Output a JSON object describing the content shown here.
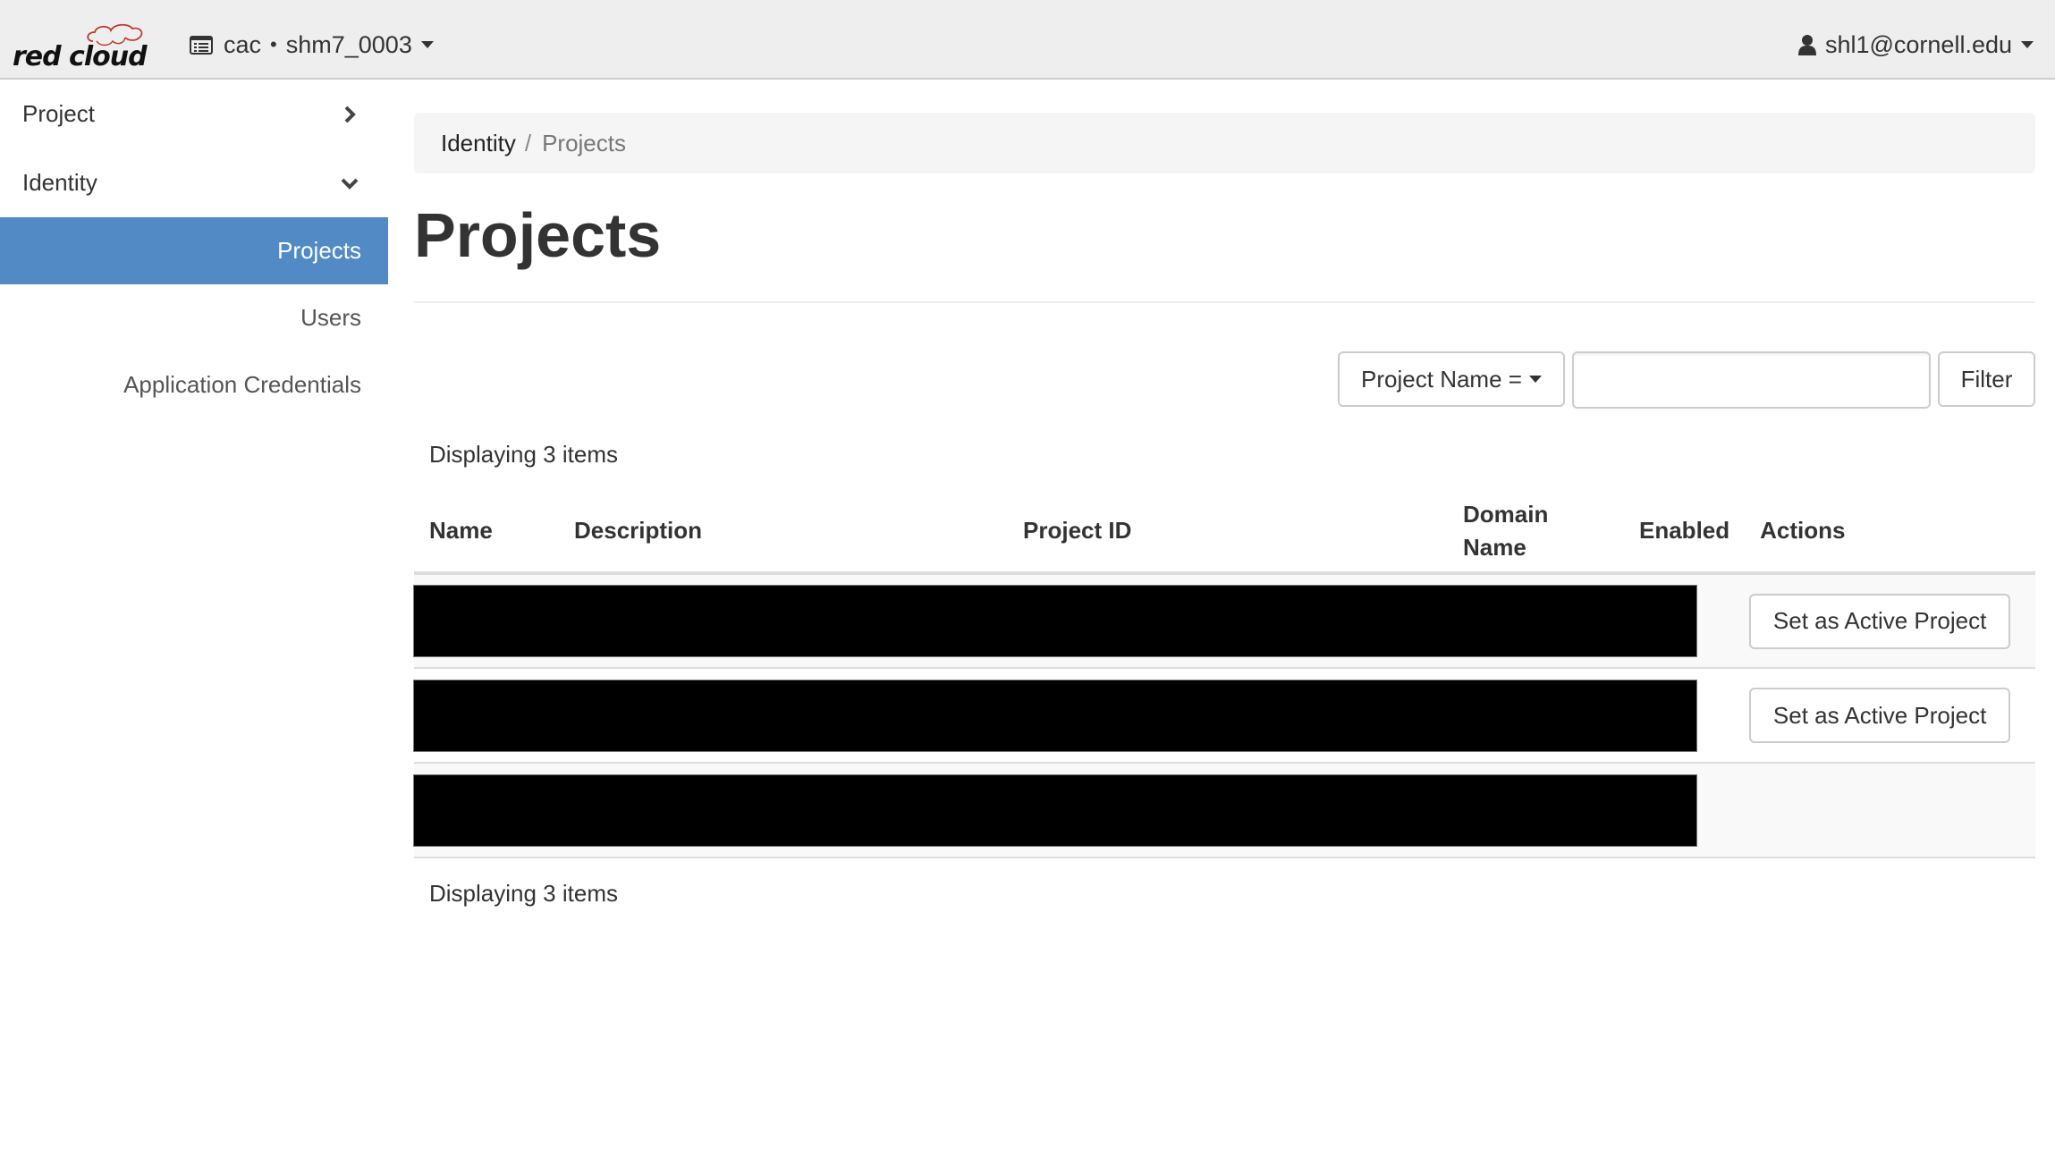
{
  "header": {
    "logo_text": "red cloud",
    "logo_accent_color": "#c0392b",
    "project_selector": {
      "icon": "list-icon",
      "domain": "cac",
      "separator": "•",
      "project": "shm7_0003"
    },
    "user_menu": {
      "icon": "user-icon",
      "email": "shl1@cornell.edu"
    }
  },
  "sidebar": {
    "groups": [
      {
        "label": "Project",
        "state": "collapsed",
        "icon": "chevron-right-icon"
      },
      {
        "label": "Identity",
        "state": "expanded",
        "icon": "chevron-down-icon"
      }
    ],
    "items": [
      {
        "label": "Projects",
        "active": true
      },
      {
        "label": "Users",
        "active": false
      },
      {
        "label": "Application Credentials",
        "active": false
      }
    ],
    "active_color": "#518ac4"
  },
  "breadcrumb": {
    "parent": "Identity",
    "separator": "/",
    "current": "Projects"
  },
  "page": {
    "title": "Projects"
  },
  "filter": {
    "field_label": "Project Name =",
    "input_value": "",
    "input_placeholder": "",
    "button_label": "Filter"
  },
  "table": {
    "count_text_top": "Displaying 3 items",
    "count_text_bottom": "Displaying 3 items",
    "columns": [
      "Name",
      "Description",
      "Project ID",
      "Domain Name",
      "Enabled",
      "Actions"
    ],
    "rows": [
      {
        "redacted": true,
        "action": "Set as Active Project"
      },
      {
        "redacted": true,
        "action": "Set as Active Project"
      },
      {
        "redacted": true,
        "action": null
      }
    ]
  }
}
